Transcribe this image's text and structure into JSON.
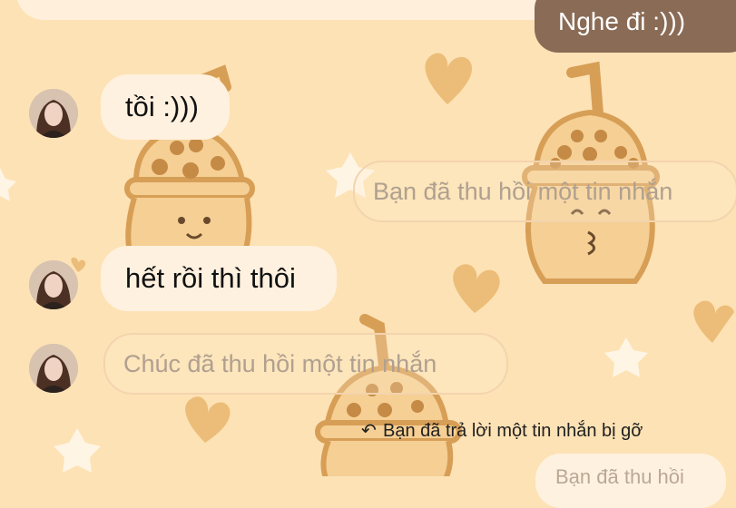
{
  "colors": {
    "background": "#fde2b5",
    "received_bubble": "#fff1df",
    "sent_bubble": "#8a6b55",
    "recalled_text": "#b0a08f",
    "wallpaper_heart": "#e7b56b",
    "wallpaper_star": "#fff5e6"
  },
  "chat": {
    "sent_partial": "Nghe đi :)))",
    "messages": [
      {
        "text": "tồi :)))"
      },
      {
        "text": "hết rồi thì thôi"
      }
    ],
    "recalled_you": "Bạn đã thu hồi một tin nhắn",
    "recalled_other": "Chúc đã thu hồi một tin nhắn",
    "reply_note": "Bạn đã trả lời một tin nhắn bị gỡ",
    "reply_icon": "reply-arrow-icon",
    "bottom_partial": "Bạn đã thu hồi"
  }
}
